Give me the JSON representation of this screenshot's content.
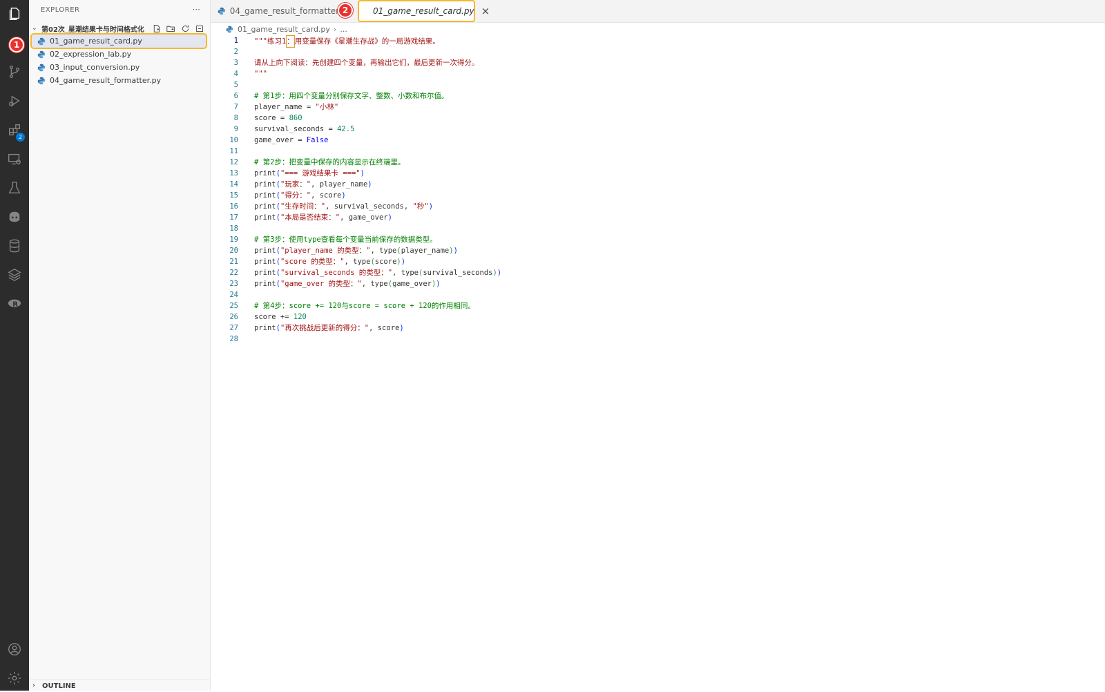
{
  "activity_bar": {
    "icons": [
      "files-icon",
      "account-step-badge",
      "source-control-icon",
      "run-debug-icon",
      "extensions-icon",
      "remote-explorer-icon",
      "testing-icon",
      "copilot-icon",
      "database-icon",
      "layers-icon",
      "r-icon",
      "account-icon",
      "settings-icon"
    ],
    "extensions_badge": "2"
  },
  "sidebar": {
    "header": "EXPLORER",
    "more": "···",
    "folder": "第02次_星潮结果卡与时间格式化",
    "files": [
      {
        "name": "01_game_result_card.py"
      },
      {
        "name": "02_expression_lab.py"
      },
      {
        "name": "03_input_conversion.py"
      },
      {
        "name": "04_game_result_formatter.py"
      }
    ],
    "outline": "OUTLINE"
  },
  "tabs": [
    {
      "label": "04_game_result_formatter.py"
    },
    {
      "label": "01_game_result_card.py"
    }
  ],
  "step_badges": [
    "1",
    "2"
  ],
  "breadcrumb": {
    "file": "01_game_result_card.py",
    "more": "..."
  },
  "editor": {
    "line_numbers": [
      "1",
      "2",
      "3",
      "4",
      "5",
      "6",
      "7",
      "8",
      "9",
      "10",
      "11",
      "12",
      "13",
      "14",
      "15",
      "16",
      "17",
      "18",
      "19",
      "20",
      "21",
      "22",
      "23",
      "24",
      "25",
      "26",
      "27",
      "28"
    ],
    "lines": {
      "l1a": "\"\"\"练习1",
      "l1b": "：",
      "l1c": "用变量保存《星潮生存战》的一局游戏结果。",
      "l3": "请从上向下阅读：先创建四个变量，再输出它们，最后更新一次得分。",
      "l4": "\"\"\"",
      "l6": "# 第1步：用四个变量分别保存文字、整数、小数和布尔值。",
      "l7a": "player_name = ",
      "l7b": "\"小林\"",
      "l8a": "score = ",
      "l8b": "860",
      "l9a": "survival_seconds = ",
      "l9b": "42.5",
      "l10a": "game_over = ",
      "l10b": "False",
      "l12": "# 第2步：把变量中保存的内容显示在终端里。",
      "l13a": "print",
      "l13b": "(",
      "l13c": "\"=== 游戏结果卡 ===\"",
      "l13d": ")",
      "l14c": "\"玩家：\"",
      "l14e": ", player_name",
      "l15c": "\"得分：\"",
      "l15e": ", score",
      "l16c": "\"生存时间：\"",
      "l16e": ", survival_seconds, ",
      "l16f": "\"秒\"",
      "l17c": "\"本局是否结束：\"",
      "l17e": ", game_over",
      "l19": "# 第3步：使用type查看每个变量当前保存的数据类型。",
      "l20c": "\"player_name 的类型：\"",
      "l20e": ", type",
      "l20f": "player_name",
      "l21c": "\"score 的类型：\"",
      "l21f": "score",
      "l22c": "\"survival_seconds 的类型：\"",
      "l22f": "survival_seconds",
      "l23c": "\"game_over 的类型：\"",
      "l23f": "game_over",
      "l25": "# 第4步：score += 120与score = score + 120的作用相同。",
      "l26a": "score += ",
      "l26b": "120",
      "l27c": "\"再次挑战后更新的得分：\"",
      "l27e": ", score"
    }
  },
  "colors": {
    "highlight": "#f5b82e",
    "badge": "#e8322e",
    "string": "#a31515",
    "comment": "#008000",
    "number": "#098658",
    "keyword": "#0000ff"
  }
}
